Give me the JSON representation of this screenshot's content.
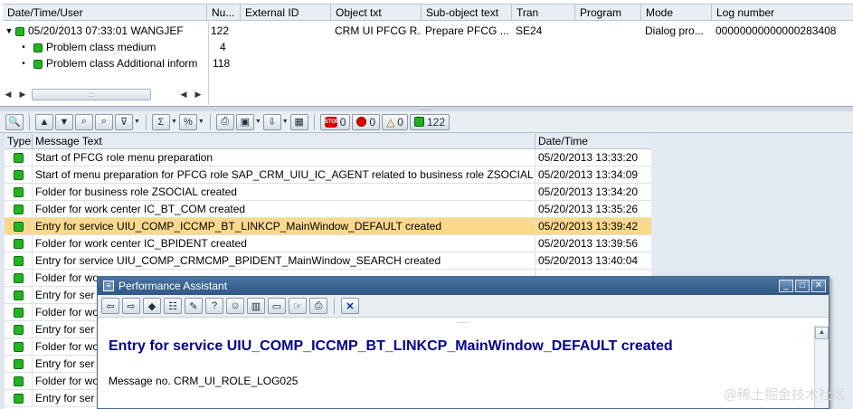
{
  "log_tree": {
    "columns": [
      "Date/Time/User",
      "Nu...",
      "External ID",
      "Object txt",
      "Sub-object text",
      "Tran",
      "Program",
      "Mode",
      "Log number"
    ],
    "main_row": {
      "toggle": "▼",
      "datetime_user": "05/20/2013  07:33:01  WANGJEF",
      "number": "122",
      "external_id": "",
      "object_txt": "CRM UI PFCG R...",
      "sub_object": "Prepare PFCG ...",
      "tran": "SE24",
      "program": "",
      "mode": "Dialog pro...",
      "log_number": "00000000000000283408"
    },
    "children": [
      {
        "label": "Problem class medium",
        "count": "4"
      },
      {
        "label": "Problem class Additional inform",
        "count": "118"
      }
    ]
  },
  "toolbar": {
    "counters": {
      "stop": "0",
      "error": "0",
      "warning": "0",
      "success": "122"
    }
  },
  "message_list": {
    "headers": {
      "type": "Type",
      "text": "Message Text",
      "date": "Date/Time"
    },
    "rows": [
      {
        "text": "Start of PFCG role menu preparation",
        "date": "05/20/2013 13:33:20",
        "selected": false
      },
      {
        "text": "Start of menu preparation for PFCG role SAP_CRM_UIU_IC_AGENT related to business role ZSOCIAL",
        "date": "05/20/2013 13:34:09",
        "selected": false
      },
      {
        "text": "Folder for business role ZSOCIAL created",
        "date": "05/20/2013 13:34:20",
        "selected": false
      },
      {
        "text": "Folder for work center IC_BT_COM created",
        "date": "05/20/2013 13:35:26",
        "selected": false
      },
      {
        "text": "Entry for service UIU_COMP_ICCMP_BT_LINKCP_MainWindow_DEFAULT created",
        "date": "05/20/2013 13:39:42",
        "selected": true
      },
      {
        "text": "Folder for work center IC_BPIDENT created",
        "date": "05/20/2013 13:39:56",
        "selected": false
      },
      {
        "text": "Entry for service UIU_COMP_CRMCMP_BPIDENT_MainWindow_SEARCH created",
        "date": "05/20/2013 13:40:04",
        "selected": false
      },
      {
        "text": "Folder for wo",
        "date": "",
        "selected": false
      },
      {
        "text": "Entry for ser",
        "date": "",
        "selected": false
      },
      {
        "text": "Folder for wo",
        "date": "",
        "selected": false
      },
      {
        "text": "Entry for ser",
        "date": "",
        "selected": false
      },
      {
        "text": "Folder for wo",
        "date": "",
        "selected": false
      },
      {
        "text": "Entry for ser",
        "date": "",
        "selected": false
      },
      {
        "text": "Folder for wo",
        "date": "",
        "selected": false
      },
      {
        "text": "Entry for ser",
        "date": "",
        "selected": false
      }
    ]
  },
  "popup": {
    "title": "Performance Assistant",
    "heading": "Entry for service UIU_COMP_ICCMP_BT_LINKCP_MainWindow_DEFAULT created",
    "message_no": "Message no. CRM_UI_ROLE_LOG025"
  },
  "watermark": "@稀土掘金技术社区",
  "colors": {
    "selected_row": "#fbd98a",
    "led_green": "#22b522",
    "popup_title": "#2f5886",
    "heading": "#00008b"
  }
}
